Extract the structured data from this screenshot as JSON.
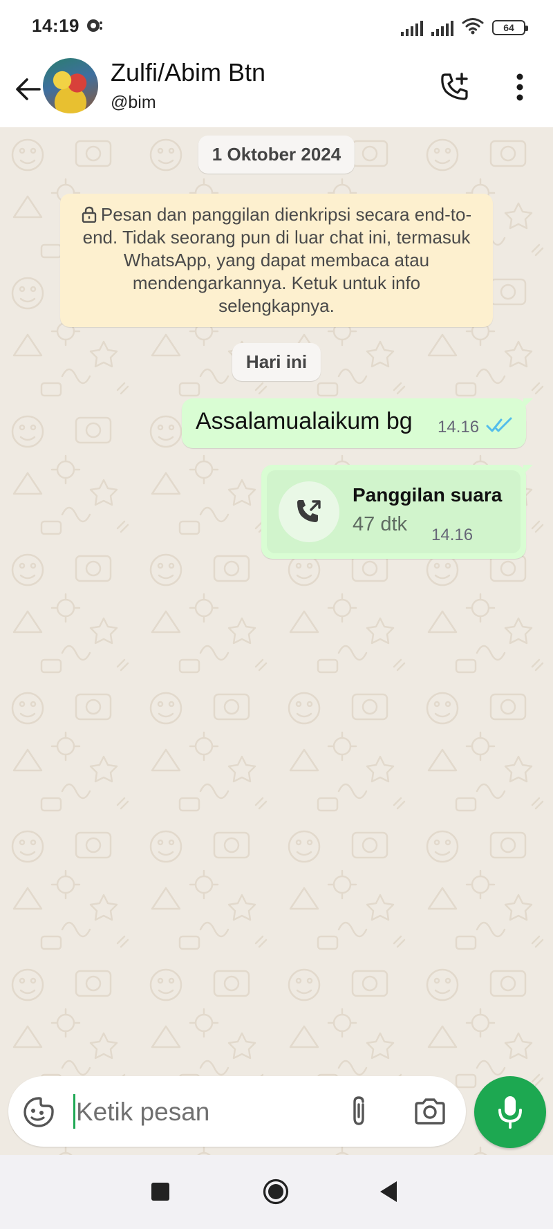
{
  "status_bar": {
    "time": "14:19",
    "battery": "64",
    "icons": [
      "notification-icon",
      "signal-icon",
      "signal-icon",
      "wifi-icon",
      "battery-icon"
    ]
  },
  "header": {
    "contact_name": "Zulfi/Abim Btn",
    "contact_subtitle": "@bim",
    "icons": [
      "back-arrow-icon",
      "add-call-icon",
      "more-vert-icon"
    ]
  },
  "chat": {
    "date_label": "1 Oktober 2024",
    "encryption_notice": "Pesan dan panggilan dienkripsi secara end-to-end. Tidak seorang pun di luar chat ini, termasuk WhatsApp, yang dapat membaca atau mendengarkannya. Ketuk untuk info selengkapnya.",
    "today_label": "Hari ini",
    "messages": [
      {
        "type": "text",
        "direction": "outgoing",
        "text": "Assalamualaikum bg",
        "time": "14.16",
        "status": "read"
      },
      {
        "type": "call",
        "direction": "outgoing",
        "title": "Panggilan suara",
        "duration": "47 dtk",
        "time": "14.16"
      }
    ]
  },
  "composer": {
    "placeholder": "Ketik pesan",
    "value": "",
    "icons": [
      "sticker-icon",
      "attach-icon",
      "camera-icon",
      "mic-icon"
    ]
  },
  "colors": {
    "chat_background": "#efeae2",
    "outgoing_bubble": "#d9fdd3",
    "notice_background": "#fdf0cf",
    "accent_green": "#1da851",
    "read_tick_blue": "#53bdeb"
  }
}
